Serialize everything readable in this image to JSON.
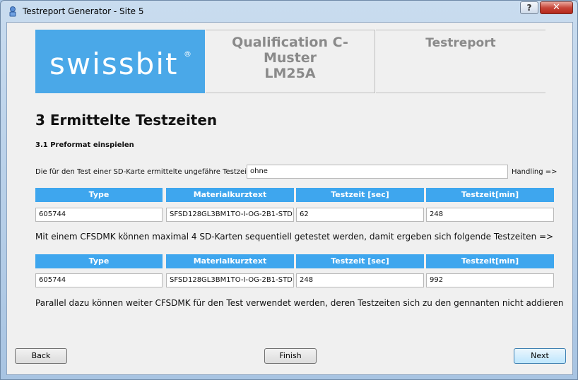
{
  "window": {
    "title": "Testreport Generator - Site 5",
    "help_label": "?",
    "close_label": "✕"
  },
  "header": {
    "logo_text": "swissbit",
    "logo_reg": "®",
    "qualification": [
      "Qualification C-",
      "Muster",
      "LM25A"
    ],
    "testreport": "Testreport",
    "logo_color": "#4aa8e8"
  },
  "section": {
    "title": "3 Ermittelte Testzeiten",
    "subtitle": "3.1 Preformat einspielen"
  },
  "testzeit_row": {
    "label": "Die für den Test einer SD-Karte ermittelte ungefähre Testzeit",
    "value": "ohne",
    "handling": "Handling =>"
  },
  "table_headers": [
    "Type",
    "Materialkurztext",
    "Testzeit [sec]",
    "Testzeit[min]"
  ],
  "table1": [
    "605744",
    "SFSD128GL3BM1TO-I-OG-2B1-STD",
    "62",
    "248"
  ],
  "paragraph1": "Mit einem CFSDMK können maximal 4 SD-Karten sequentiell getestet werden, damit ergeben sich folgende Testzeiten =>",
  "table2": [
    "605744",
    "SFSD128GL3BM1TO-I-OG-2B1-STD",
    "248",
    "992"
  ],
  "paragraph2": "Parallel dazu können weiter CFSDMK für den Test verwendet werden, deren Testzeiten sich zu den gennanten nicht addieren",
  "buttons": {
    "back": "Back",
    "finish": "Finish",
    "next": "Next"
  },
  "accent_color": "#3ea6ee"
}
